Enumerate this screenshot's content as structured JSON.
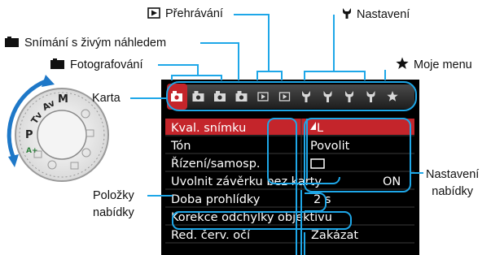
{
  "callouts": {
    "playback": "Přehrávání",
    "setup": "Nastavení",
    "live_view": "Snímání s živým náhledem",
    "shooting": "Fotografování",
    "my_menu": "Moje menu",
    "tab": "Karta",
    "menu_items": [
      "Položky",
      "nabídky"
    ],
    "menu_settings": [
      "Nastavení",
      "nabídky"
    ]
  },
  "tab_icons": [
    "camera-icon",
    "camera-icon",
    "camera-icon",
    "camera-icon",
    "playback-icon",
    "playback-icon",
    "wrench-icon",
    "wrench-icon",
    "wrench-icon",
    "wrench-icon",
    "star-icon"
  ],
  "menu": {
    "selected_index": 0,
    "rows": [
      {
        "item": "Kval. snímku",
        "value": "L"
      },
      {
        "item": "Tón",
        "value": "Povolit"
      },
      {
        "item": "Řízení/samosp.",
        "value": ""
      },
      {
        "item": "Uvolnit závěrku bez karty",
        "value": "ON"
      },
      {
        "item": "Doba prohlídky",
        "value": "2 s"
      },
      {
        "item": "Korekce odchylky objektivu",
        "value": ""
      },
      {
        "item": "Red. červ. očí",
        "value": "Zakázat"
      }
    ]
  },
  "dial": {
    "marks": [
      "M",
      "Av",
      "Tv",
      "P",
      "A+"
    ]
  },
  "colors": {
    "screen": "#000000",
    "selected_row": "#c4252b",
    "tab_bar": "#2a2a2a",
    "active_tab": "#c4252b",
    "leader": "#1ea7e8",
    "arrow": "#1e78c8"
  }
}
